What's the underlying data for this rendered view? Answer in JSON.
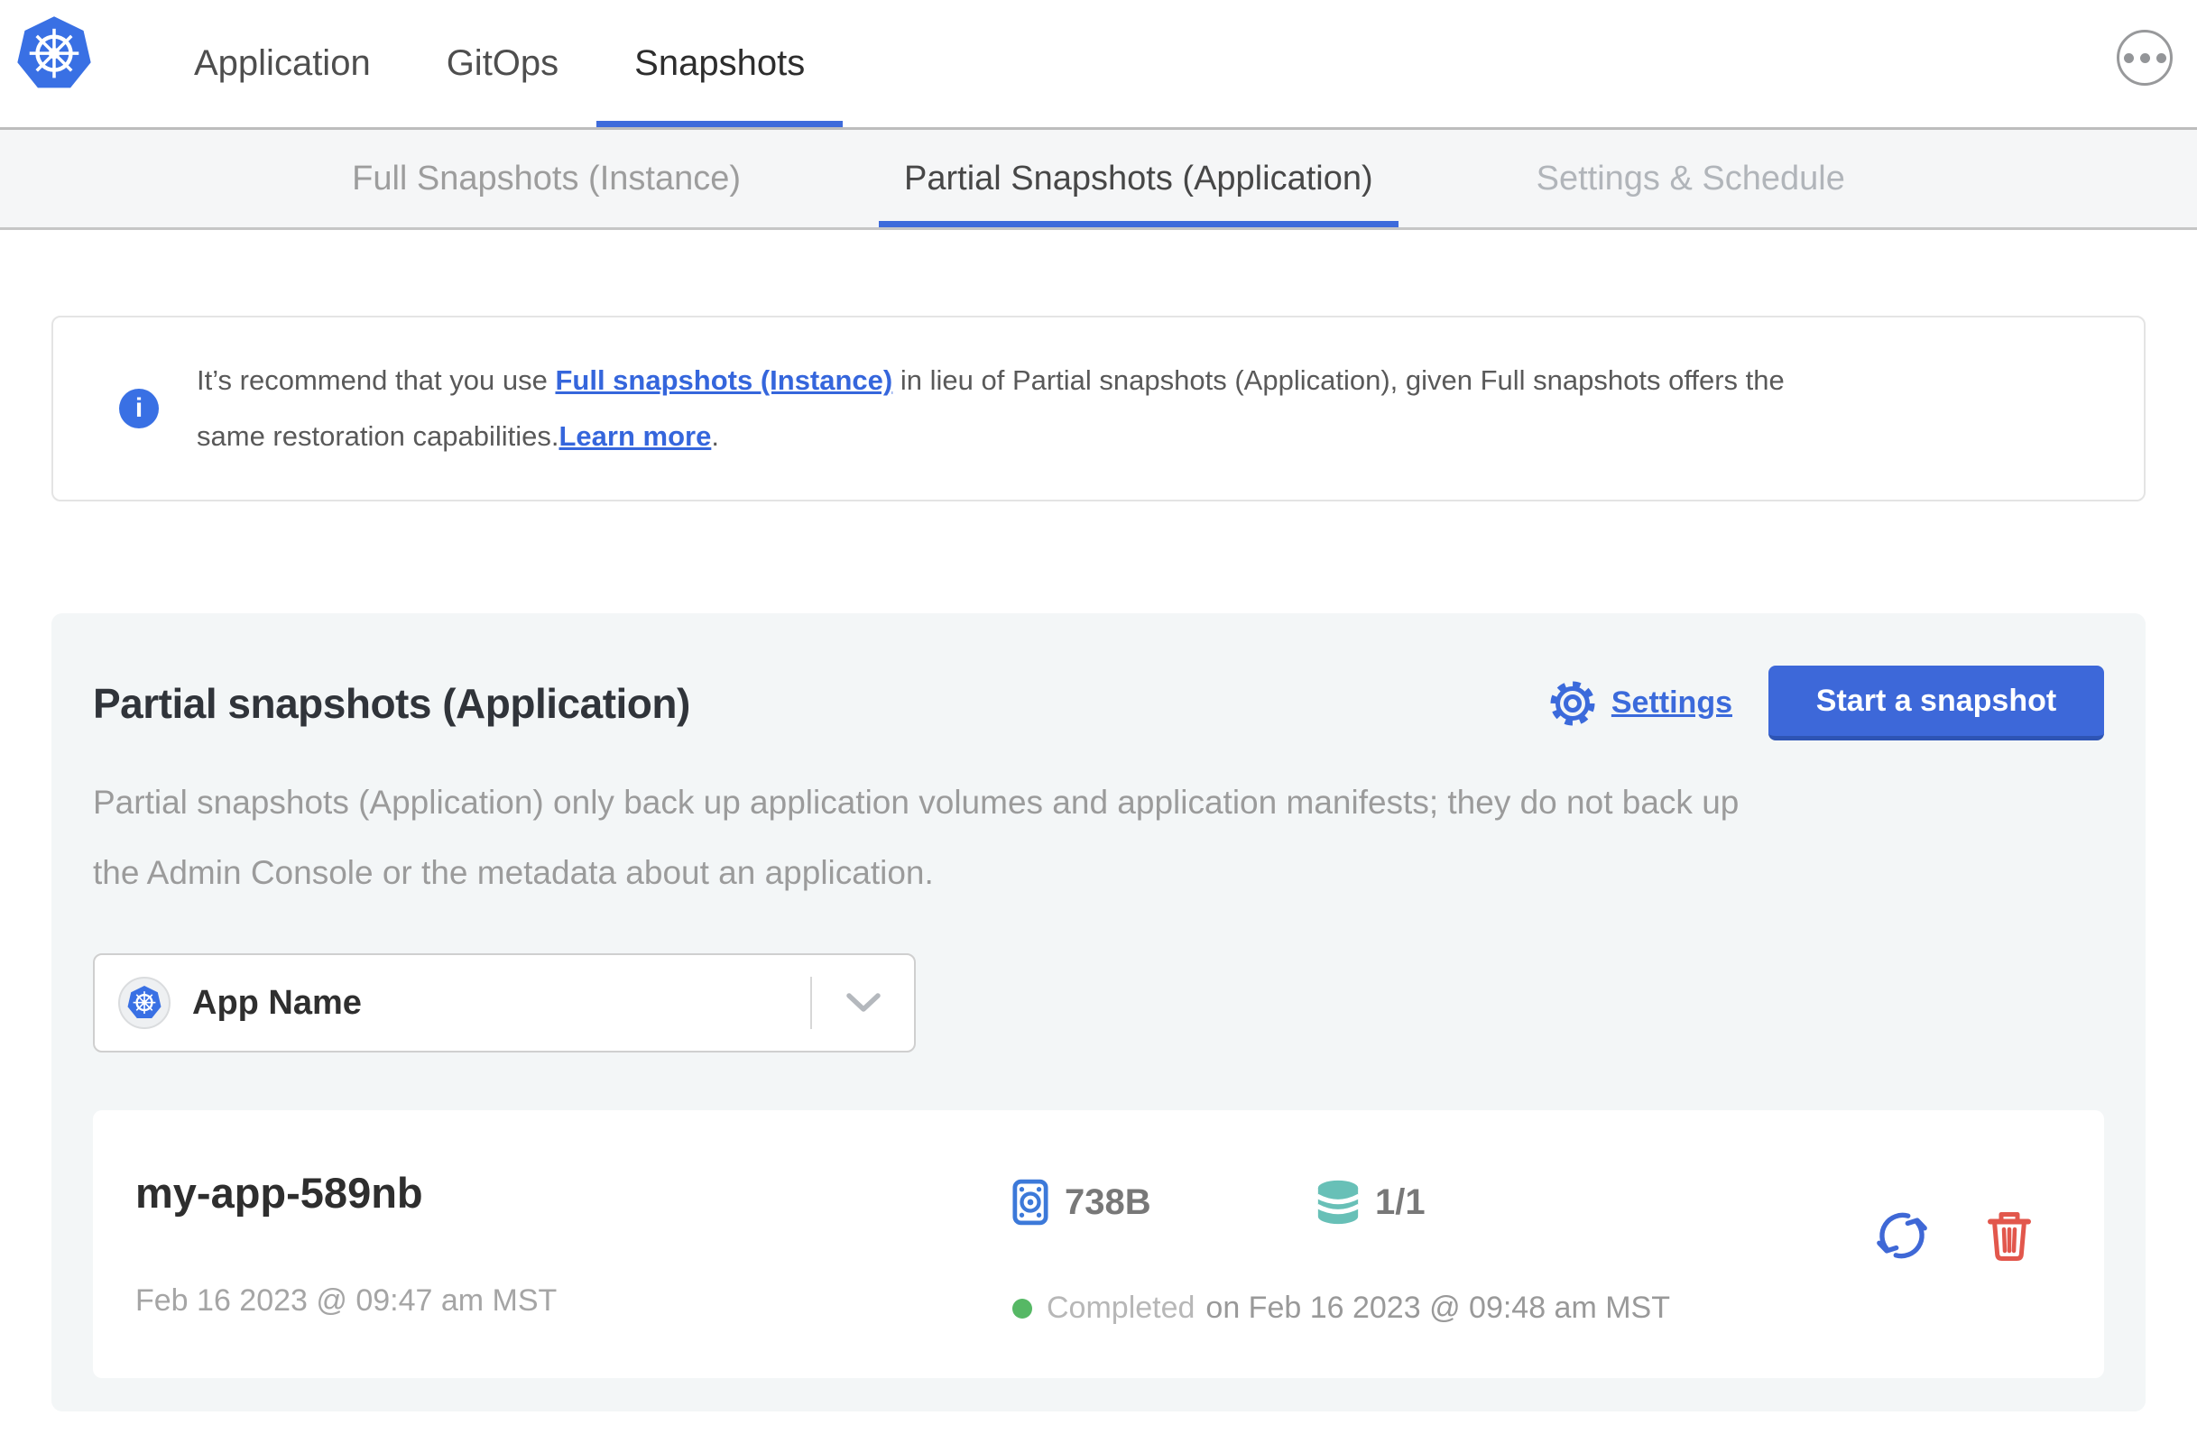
{
  "header": {
    "nav_items": [
      {
        "label": "Application",
        "active": false
      },
      {
        "label": "GitOps",
        "active": false
      },
      {
        "label": "Snapshots",
        "active": true
      }
    ]
  },
  "subnav": {
    "tabs": [
      {
        "label": "Full Snapshots (Instance)",
        "active": false
      },
      {
        "label": "Partial Snapshots (Application)",
        "active": true
      },
      {
        "label": "Settings & Schedule",
        "active": false
      }
    ]
  },
  "banner": {
    "text_intro": "It’s recommend that you use ",
    "link_full_snapshots": "Full snapshots (Instance)",
    "text_line1_rest": " in lieu of Partial snapshots (Application), given Full snapshots offers the",
    "text_line2_start": "same restoration capabilities.",
    "link_learn_more": "Learn more",
    "text_line2_end": "."
  },
  "panel": {
    "title": "Partial snapshots (Application)",
    "settings_label": "Settings",
    "start_snapshot_label": "Start a snapshot",
    "description_lines": [
      "Partial snapshots (Application) only back up application volumes and application manifests; they do not back up",
      "the Admin Console or the metadata about an application."
    ],
    "app_selector_value": "App Name"
  },
  "snapshot": {
    "name": "my-app-589nb",
    "created_at": "Feb 16 2023 @ 09:47 am MST",
    "size": "738B",
    "volume_count": "1/1",
    "status": "Completed",
    "completed_at": "on Feb 16 2023 @ 09:48 am MST"
  },
  "icons": {
    "logo": "kubernetes-wheel",
    "more_menu": "ellipsis-circle",
    "banner": "info-circle",
    "settings": "gear",
    "app_selector_left": "kubernetes-wheel",
    "app_selector_right": "chevron-down",
    "size": "disk",
    "volumes": "database-stack",
    "restore": "circular-arrows",
    "delete": "trash"
  },
  "colors": {
    "accent_blue": "#3e6bdb",
    "link_blue": "#3566dc",
    "kubernetes_blue": "#3970e4",
    "disk_blue": "#3c79d9",
    "database_teal": "#68c0b7",
    "delete_red": "#e2574c",
    "status_green": "#56b865",
    "panel_gray": "#f3f6f7"
  }
}
